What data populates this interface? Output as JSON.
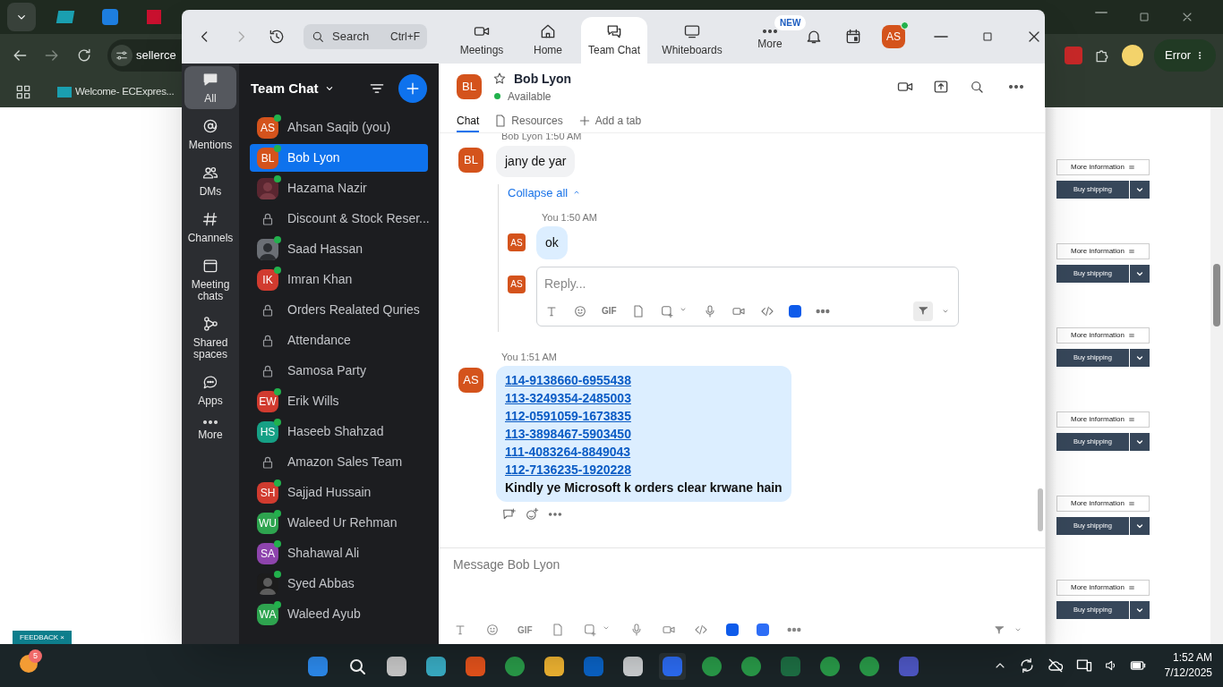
{
  "browser": {
    "address": "sellerce",
    "bookmark": "Welcome- ECExpres...",
    "error_button": "Error",
    "feedback": "FEEDBACK",
    "feedback_close": "×"
  },
  "page_actions": [
    {
      "info": "More information",
      "ship": "Buy shipping"
    },
    {
      "info": "More information",
      "ship": "Buy shipping"
    },
    {
      "info": "More information",
      "ship": "Buy shipping"
    },
    {
      "info": "More information",
      "ship": "Buy shipping"
    },
    {
      "info": "More information",
      "ship": "Buy shipping"
    },
    {
      "info": "More information",
      "ship": "Buy shipping"
    }
  ],
  "zoom": {
    "search": {
      "placeholder": "Search",
      "shortcut": "Ctrl+F"
    },
    "tabs": [
      {
        "kind": "meetings",
        "label": "Meetings",
        "selected": false
      },
      {
        "kind": "home",
        "label": "Home",
        "selected": false
      },
      {
        "kind": "chat",
        "label": "Team Chat",
        "selected": true
      },
      {
        "kind": "whiteboards",
        "label": "Whiteboards",
        "selected": false
      },
      {
        "kind": "more",
        "label": "More",
        "selected": false,
        "badge": "NEW"
      }
    ],
    "user_avatar": "AS",
    "rail": [
      {
        "kind": "all",
        "label": "All",
        "selected": true
      },
      {
        "kind": "mentions",
        "label": "Mentions",
        "selected": false
      },
      {
        "kind": "dms",
        "label": "DMs",
        "selected": false
      },
      {
        "kind": "channels",
        "label": "Channels",
        "selected": false
      },
      {
        "kind": "meeting",
        "label": "Meeting chats",
        "selected": false
      },
      {
        "kind": "shared",
        "label": "Shared spaces",
        "selected": false
      },
      {
        "kind": "apps",
        "label": "Apps",
        "selected": false
      },
      {
        "kind": "more",
        "label": "More",
        "selected": false
      }
    ],
    "list_title": "Team Chat",
    "chats": [
      {
        "kind": "avatar",
        "initials": "AS",
        "color": "#d4531c",
        "name": "Ahsan Saqib (you)",
        "online": true,
        "selected": false
      },
      {
        "kind": "avatar",
        "initials": "BL",
        "color": "#d4531c",
        "name": "Bob Lyon",
        "online": true,
        "selected": true
      },
      {
        "name": "Hazama Nazir",
        "online": true,
        "selected": false
      },
      {
        "kind": "channel",
        "name": "Discount & Stock Reser...",
        "online": false,
        "selected": false
      },
      {
        "name": "Saad Hassan",
        "online": true,
        "selected": false
      },
      {
        "kind": "avatar",
        "initials": "IK",
        "color": "#d13b2f",
        "name": "Imran Khan",
        "online": true,
        "selected": false
      },
      {
        "kind": "channel",
        "name": "Orders Realated Quries",
        "online": false,
        "selected": false
      },
      {
        "kind": "channel",
        "name": "Attendance",
        "online": false,
        "selected": false
      },
      {
        "kind": "channel",
        "name": "Samosa Party",
        "online": false,
        "selected": false
      },
      {
        "kind": "avatar",
        "initials": "EW",
        "color": "#d13b2f",
        "name": "Erik Wills",
        "online": true,
        "selected": false
      },
      {
        "kind": "avatar",
        "initials": "HS",
        "color": "#16a085",
        "name": "Haseeb Shahzad",
        "online": true,
        "selected": false
      },
      {
        "kind": "channel",
        "name": "Amazon Sales Team",
        "online": false,
        "selected": false
      },
      {
        "kind": "avatar",
        "initials": "SH",
        "color": "#d13b2f",
        "name": "Sajjad Hussain",
        "online": true,
        "selected": false
      },
      {
        "kind": "avatar",
        "initials": "WU",
        "color": "#2ea44f",
        "name": "Waleed Ur Rehman",
        "online": true,
        "selected": false
      },
      {
        "kind": "avatar",
        "initials": "SA",
        "color": "#8e44ad",
        "name": "Shahawal Ali",
        "online": true,
        "selected": false
      },
      {
        "name": "Syed Abbas",
        "online": true,
        "selected": false
      },
      {
        "kind": "avatar",
        "initials": "WA",
        "color": "#2ea44f",
        "name": "Waleed Ayub",
        "online": true,
        "selected": false
      }
    ],
    "conversation": {
      "initials": "BL",
      "name": "Bob Lyon",
      "status": "Available",
      "tabs": [
        {
          "kind": "chat",
          "label": "Chat",
          "selected": true
        },
        {
          "kind": "resources",
          "label": "Resources",
          "selected": false
        },
        {
          "kind": "add",
          "label": "Add a tab",
          "selected": false
        }
      ],
      "first": {
        "initials": "BL",
        "sender": "Bob Lyon",
        "time": "1:50 AM",
        "text": "jany de yar"
      },
      "collapse": "Collapse all",
      "reply": {
        "initials": "AS",
        "sender": "You",
        "time": "1:50 AM",
        "text": "ok"
      },
      "reply_box": {
        "initials": "AS",
        "placeholder": "Reply...",
        "gif": "GIF"
      },
      "second": {
        "initials": "AS",
        "sender": "You",
        "time": "1:51 AM",
        "links": [
          "114-9138660-6955438",
          "113-3249354-2485003",
          "112-0591059-1673835",
          "113-3898467-5903450",
          "111-4083264-8849043",
          "112-7136235-1920228"
        ],
        "text": "Kindly ye Microsoft k orders clear krwane hain"
      },
      "composer": {
        "placeholder": "Message Bob Lyon",
        "gif": "GIF"
      }
    }
  },
  "taskbar": {
    "badge": "5",
    "time": "1:52 AM",
    "date": "7/12/2025"
  }
}
